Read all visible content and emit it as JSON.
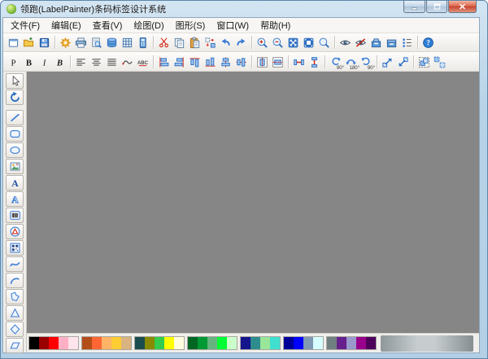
{
  "window": {
    "title": "领跑(LabelPainter)条码标签设计系统",
    "app_icon": "app-logo-icon",
    "controls": [
      {
        "name": "minimize-button",
        "icon": "minimize-icon"
      },
      {
        "name": "maximize-button",
        "icon": "maximize-icon"
      },
      {
        "name": "close-button",
        "icon": "close-icon"
      }
    ]
  },
  "menubar": {
    "items": [
      {
        "name": "menu-file",
        "label": "文件(F)"
      },
      {
        "name": "menu-edit",
        "label": "编辑(E)"
      },
      {
        "name": "menu-view",
        "label": "查看(V)"
      },
      {
        "name": "menu-draw",
        "label": "绘图(D)"
      },
      {
        "name": "menu-shape",
        "label": "图形(S)"
      },
      {
        "name": "menu-window",
        "label": "窗口(W)"
      },
      {
        "name": "menu-help",
        "label": "帮助(H)"
      }
    ]
  },
  "toolbar_main": {
    "groups": [
      [
        {
          "name": "new-document",
          "icon": "doc-new-icon"
        },
        {
          "name": "open-file",
          "icon": "folder-open-icon"
        },
        {
          "name": "save-file",
          "icon": "save-icon"
        }
      ],
      [
        {
          "name": "settings",
          "icon": "gear-icon"
        },
        {
          "name": "print",
          "icon": "printer-icon"
        },
        {
          "name": "print-preview",
          "icon": "print-preview-icon"
        },
        {
          "name": "database",
          "icon": "database-icon"
        },
        {
          "name": "grid-toggle",
          "icon": "grid-icon"
        },
        {
          "name": "label-setup",
          "icon": "calculator-icon"
        }
      ],
      [
        {
          "name": "cut",
          "icon": "scissors-icon"
        },
        {
          "name": "copy",
          "icon": "copy-icon"
        },
        {
          "name": "paste",
          "icon": "paste-icon"
        },
        {
          "name": "transform",
          "icon": "transform-icon"
        },
        {
          "name": "undo",
          "icon": "undo-icon"
        },
        {
          "name": "redo",
          "icon": "redo-icon"
        }
      ],
      [
        {
          "name": "zoom-in",
          "icon": "zoom-in-icon"
        },
        {
          "name": "zoom-out",
          "icon": "zoom-out-icon"
        },
        {
          "name": "fit-window",
          "icon": "fit-window-icon"
        },
        {
          "name": "fit-page",
          "icon": "fit-page-icon"
        },
        {
          "name": "zoom-tool",
          "icon": "magnifier-icon"
        }
      ],
      [
        {
          "name": "show-objects",
          "icon": "eye-icon"
        },
        {
          "name": "hide-objects",
          "icon": "eye-off-icon"
        },
        {
          "name": "box-open",
          "icon": "box-open-icon"
        },
        {
          "name": "box-closed",
          "icon": "box-closed-icon"
        },
        {
          "name": "object-list",
          "icon": "options-list-icon"
        }
      ],
      [
        {
          "name": "help",
          "icon": "help-icon"
        }
      ]
    ]
  },
  "toolbar_format": {
    "groups": [
      [
        {
          "name": "font-plain",
          "icon": "letter-p-icon",
          "glyph": "P"
        },
        {
          "name": "font-bold",
          "icon": "letter-b-icon",
          "glyph": "B"
        },
        {
          "name": "font-italic",
          "icon": "letter-i-icon",
          "glyph": "I"
        },
        {
          "name": "font-bold-italic",
          "icon": "letter-bi-icon",
          "glyph": "B"
        }
      ],
      [
        {
          "name": "text-align-left",
          "icon": "text-align-left-icon"
        },
        {
          "name": "text-align-center",
          "icon": "text-align-center-icon"
        },
        {
          "name": "text-align-justify",
          "icon": "text-align-justify-icon"
        },
        {
          "name": "text-curve",
          "icon": "text-curve-icon"
        },
        {
          "name": "spell-check",
          "icon": "abc-icon",
          "glyph": "ABC"
        }
      ],
      [
        {
          "name": "align-left-edges",
          "icon": "align-left-icon"
        },
        {
          "name": "align-right-edges",
          "icon": "align-right-icon"
        },
        {
          "name": "align-top-edges",
          "icon": "align-top-icon"
        },
        {
          "name": "align-bottom-edges",
          "icon": "align-bottom-icon"
        },
        {
          "name": "align-center-vertical",
          "icon": "align-center-v-icon"
        },
        {
          "name": "align-center-horizontal",
          "icon": "align-center-h-icon"
        }
      ],
      [
        {
          "name": "center-in-page-horizontal",
          "icon": "center-page-h-icon"
        },
        {
          "name": "center-in-page-vertical",
          "icon": "center-page-v-icon"
        }
      ],
      [
        {
          "name": "equal-spacing-horizontal",
          "icon": "space-h-icon"
        },
        {
          "name": "equal-spacing-vertical",
          "icon": "space-v-icon"
        }
      ],
      [
        {
          "name": "rotate-left-90",
          "icon": "rotate-left-icon",
          "badge": "90°"
        },
        {
          "name": "rotate-180",
          "icon": "rotate-180-icon",
          "badge": "180°"
        },
        {
          "name": "rotate-right-90",
          "icon": "rotate-right-icon",
          "badge": "90°"
        }
      ],
      [
        {
          "name": "bring-forward",
          "icon": "bring-forward-icon"
        },
        {
          "name": "send-backward",
          "icon": "send-backward-icon"
        }
      ],
      [
        {
          "name": "group-objects",
          "icon": "group-icon"
        },
        {
          "name": "ungroup-objects",
          "icon": "ungroup-icon"
        }
      ]
    ]
  },
  "sidebar": {
    "groups": [
      [
        {
          "name": "select-tool",
          "icon": "select-icon"
        },
        {
          "name": "rotate-tool",
          "icon": "rotate-tool-icon"
        }
      ],
      [
        {
          "name": "line-tool",
          "icon": "line-icon"
        },
        {
          "name": "rounded-rect-tool",
          "icon": "rounded-rect-icon"
        },
        {
          "name": "ellipse-tool",
          "icon": "ellipse-icon"
        },
        {
          "name": "image-tool",
          "icon": "image-icon"
        },
        {
          "name": "text-tool",
          "icon": "text-icon",
          "glyph": "A"
        },
        {
          "name": "art-text-tool",
          "icon": "art-text-icon",
          "glyph": "A"
        },
        {
          "name": "barcode-tool",
          "icon": "barcode-icon"
        },
        {
          "name": "logo-shape-tool",
          "icon": "logo-shape-icon"
        },
        {
          "name": "qrcode-tool",
          "icon": "qrcode-icon"
        },
        {
          "name": "curve-tool",
          "icon": "curve-icon"
        },
        {
          "name": "arc-tool",
          "icon": "arc-icon"
        },
        {
          "name": "polygon-tool",
          "icon": "polygon-icon"
        },
        {
          "name": "triangle-tool",
          "icon": "triangle-icon"
        },
        {
          "name": "diamond-tool",
          "icon": "diamond-icon"
        },
        {
          "name": "parallelogram-tool",
          "icon": "parallelogram-icon"
        }
      ]
    ]
  },
  "canvas": {
    "background": "#868686"
  },
  "palette": {
    "groups": [
      [
        "#000000",
        "#990000",
        "#FF0000",
        "#FFB0C4",
        "#FFE4EE"
      ],
      [
        "#B34D1A",
        "#FF6633",
        "#FFB366",
        "#FFCC33",
        "#D9B380"
      ],
      [
        "#1A4D4D",
        "#8A8A00",
        "#33CC4D",
        "#FFFF00",
        "#FFFFE0"
      ],
      [
        "#006622",
        "#009933",
        "#66B380",
        "#00FF33",
        "#CCFFCC"
      ],
      [
        "#14148C",
        "#2E8C8C",
        "#99E699",
        "#40E0D0"
      ],
      [
        "#000099",
        "#0000FF",
        "#8099B3",
        "#D6FFFF"
      ],
      [
        "#708080",
        "#66208C",
        "#9999CC",
        "#99008C",
        "#4D0059"
      ]
    ]
  },
  "colors": {
    "frame": "#b7d3e8",
    "canvas_bg": "#868686",
    "toolbar_bg": "#eceae6",
    "close_button": "#c64530",
    "icon_blue": "#2e6fc0"
  }
}
